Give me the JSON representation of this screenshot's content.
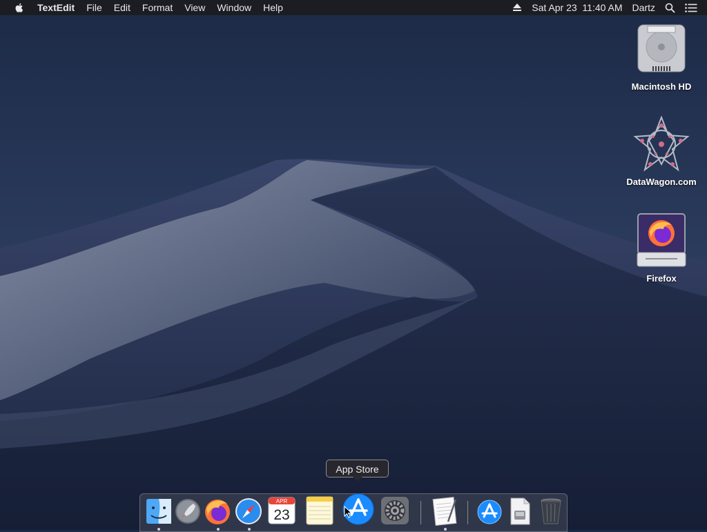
{
  "menubar": {
    "app_name": "TextEdit",
    "menus": [
      "File",
      "Edit",
      "Format",
      "View",
      "Window",
      "Help"
    ],
    "datetime": "Sat Apr 23  11:40 AM",
    "user": "Dartz"
  },
  "desktop": {
    "items": [
      {
        "label": "Macintosh HD"
      },
      {
        "label": "DataWagon.com"
      },
      {
        "label": "Firefox"
      }
    ]
  },
  "tooltip": {
    "text": "App Store"
  },
  "dock": {
    "calendar_month": "APR",
    "calendar_day": "23"
  },
  "colors": {
    "menubar_bg": "#1c1c20",
    "firefox_orange": "#ff7139",
    "appstore_blue": "#1a8cff"
  }
}
